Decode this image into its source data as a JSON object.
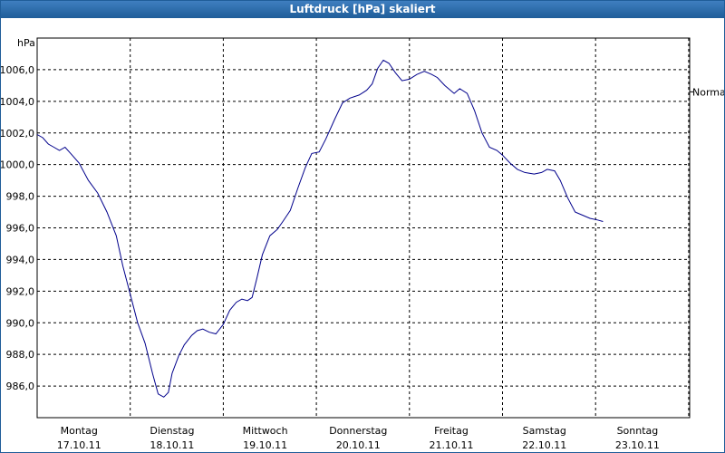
{
  "window": {
    "title": "Luftdruck [hPa] skaliert"
  },
  "colors": {
    "title_bg": "#1f5d99",
    "line": "#00008b",
    "grid": "#000000"
  },
  "chart_data": {
    "type": "line",
    "title": "Luftdruck [hPa] skaliert",
    "ylabel": "hPa",
    "xlabel": "",
    "ylim": [
      984.0,
      1008.0
    ],
    "yticks": [
      "986,0",
      "988,0",
      "990,0",
      "992,0",
      "994,0",
      "996,0",
      "998,0",
      "1000,0",
      "1002,0",
      "1004,0",
      "1006,0"
    ],
    "ytick_values": [
      986,
      988,
      990,
      992,
      994,
      996,
      998,
      1000,
      1002,
      1004,
      1006
    ],
    "xlim_days": [
      0,
      7
    ],
    "x_axis": [
      {
        "day": "Montag",
        "date": "17.10.11"
      },
      {
        "day": "Dienstag",
        "date": "18.10.11"
      },
      {
        "day": "Mittwoch",
        "date": "19.10.11"
      },
      {
        "day": "Donnerstag",
        "date": "20.10.11"
      },
      {
        "day": "Freitag",
        "date": "21.10.11"
      },
      {
        "day": "Samstag",
        "date": "22.10.11"
      },
      {
        "day": "Sonntag",
        "date": "23.10.11"
      }
    ],
    "reference": {
      "label": "Normal",
      "value": 1004.6
    },
    "grid": true,
    "series": [
      {
        "values": [
          [
            0.0,
            1001.9
          ],
          [
            0.06,
            1001.7
          ],
          [
            0.12,
            1001.3
          ],
          [
            0.18,
            1001.1
          ],
          [
            0.24,
            1000.9
          ],
          [
            0.3,
            1001.1
          ],
          [
            0.36,
            1000.7
          ],
          [
            0.45,
            1000.1
          ],
          [
            0.55,
            999.0
          ],
          [
            0.65,
            998.2
          ],
          [
            0.75,
            997.0
          ],
          [
            0.85,
            995.5
          ],
          [
            0.92,
            993.6
          ],
          [
            1.0,
            991.8
          ],
          [
            1.08,
            990.0
          ],
          [
            1.16,
            988.7
          ],
          [
            1.24,
            986.8
          ],
          [
            1.3,
            985.5
          ],
          [
            1.36,
            985.3
          ],
          [
            1.41,
            985.6
          ],
          [
            1.45,
            986.8
          ],
          [
            1.52,
            987.9
          ],
          [
            1.58,
            988.6
          ],
          [
            1.66,
            989.2
          ],
          [
            1.72,
            989.5
          ],
          [
            1.78,
            989.6
          ],
          [
            1.85,
            989.4
          ],
          [
            1.92,
            989.3
          ],
          [
            2.0,
            989.9
          ],
          [
            2.07,
            990.8
          ],
          [
            2.14,
            991.3
          ],
          [
            2.2,
            991.5
          ],
          [
            2.26,
            991.4
          ],
          [
            2.31,
            991.6
          ],
          [
            2.36,
            992.8
          ],
          [
            2.42,
            994.3
          ],
          [
            2.5,
            995.5
          ],
          [
            2.58,
            995.9
          ],
          [
            2.64,
            996.4
          ],
          [
            2.72,
            997.1
          ],
          [
            2.8,
            998.5
          ],
          [
            2.88,
            999.8
          ],
          [
            2.95,
            1000.7
          ],
          [
            3.03,
            1000.8
          ],
          [
            3.1,
            1001.6
          ],
          [
            3.2,
            1002.9
          ],
          [
            3.28,
            1003.9
          ],
          [
            3.36,
            1004.2
          ],
          [
            3.46,
            1004.4
          ],
          [
            3.54,
            1004.7
          ],
          [
            3.6,
            1005.1
          ],
          [
            3.66,
            1006.1
          ],
          [
            3.72,
            1006.6
          ],
          [
            3.78,
            1006.4
          ],
          [
            3.85,
            1005.8
          ],
          [
            3.92,
            1005.3
          ],
          [
            4.0,
            1005.4
          ],
          [
            4.08,
            1005.7
          ],
          [
            4.16,
            1005.9
          ],
          [
            4.24,
            1005.7
          ],
          [
            4.3,
            1005.5
          ],
          [
            4.38,
            1005.0
          ],
          [
            4.48,
            1004.5
          ],
          [
            4.54,
            1004.8
          ],
          [
            4.62,
            1004.5
          ],
          [
            4.7,
            1003.4
          ],
          [
            4.78,
            1002.0
          ],
          [
            4.86,
            1001.1
          ],
          [
            4.94,
            1000.9
          ],
          [
            5.0,
            1000.6
          ],
          [
            5.08,
            1000.1
          ],
          [
            5.16,
            999.7
          ],
          [
            5.24,
            999.5
          ],
          [
            5.34,
            999.4
          ],
          [
            5.42,
            999.5
          ],
          [
            5.48,
            999.7
          ],
          [
            5.56,
            999.6
          ],
          [
            5.62,
            999.0
          ],
          [
            5.7,
            997.9
          ],
          [
            5.78,
            997.0
          ],
          [
            5.86,
            996.8
          ],
          [
            5.94,
            996.6
          ],
          [
            6.02,
            996.5
          ],
          [
            6.08,
            996.4
          ]
        ]
      }
    ]
  }
}
